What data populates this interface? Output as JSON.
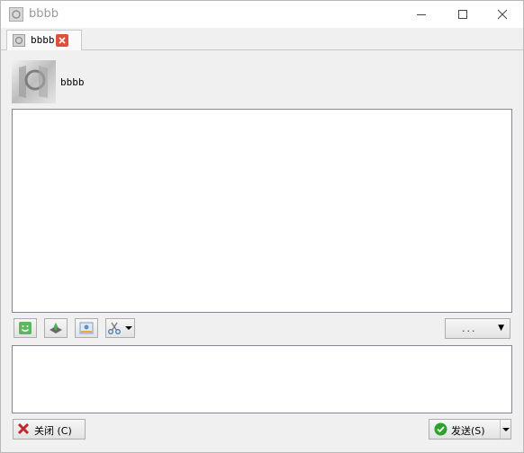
{
  "window": {
    "title": "bbbb"
  },
  "tabs": [
    {
      "label": "bbbb",
      "active": true
    }
  ],
  "contact": {
    "name": "bbbb"
  },
  "toolbar": {
    "icons": [
      "emoji-icon",
      "file-transfer-icon",
      "image-icon",
      "scissors-icon"
    ],
    "more_label": "..."
  },
  "buttons": {
    "close_label": "关闭 (C)",
    "send_label": "发送(S)"
  },
  "colors": {
    "tab_close": "#e04f3a",
    "send_check": "#2ca32c",
    "close_x": "#c0272d",
    "emoji": "#4caf50"
  }
}
